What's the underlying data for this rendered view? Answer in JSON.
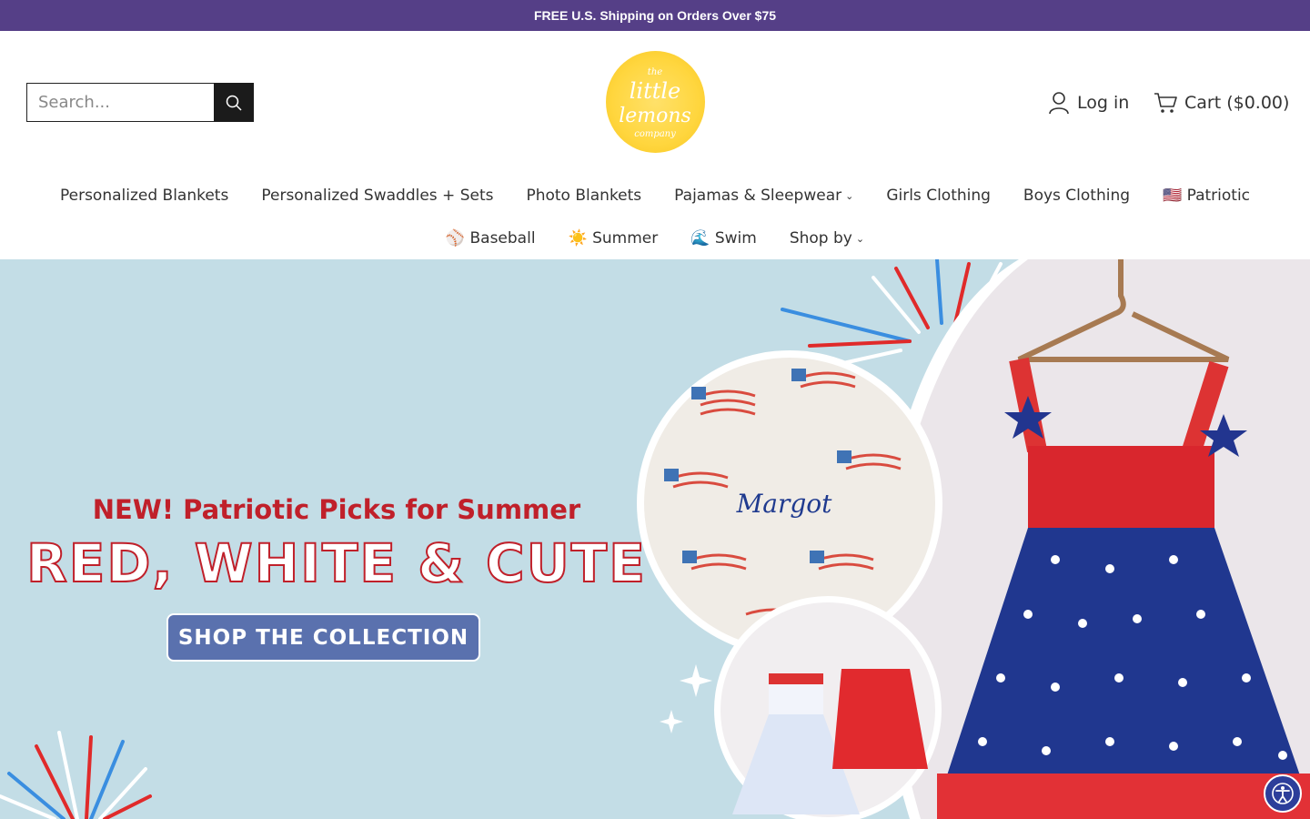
{
  "announcement": "FREE U.S. Shipping on Orders Over $75",
  "search": {
    "placeholder": "Search..."
  },
  "logo": {
    "alt": "the little lemons company"
  },
  "account": {
    "login_label": "Log in"
  },
  "cart": {
    "label": "Cart ($0.00)"
  },
  "nav": {
    "row1": [
      {
        "label": "Personalized Blankets"
      },
      {
        "label": "Personalized Swaddles + Sets"
      },
      {
        "label": "Photo Blankets"
      },
      {
        "label": "Pajamas & Sleepwear",
        "dropdown": true
      },
      {
        "label": "Girls Clothing"
      },
      {
        "label": "Boys Clothing"
      },
      {
        "label": "🇺🇸 Patriotic"
      }
    ],
    "row2": [
      {
        "label": "⚾ Baseball"
      },
      {
        "label": "☀️ Summer"
      },
      {
        "label": "🌊 Swim"
      },
      {
        "label": "Shop by",
        "dropdown": true
      }
    ]
  },
  "hero": {
    "kicker": "NEW! Patriotic Picks for Summer",
    "title": "RED, WHITE & CUTE",
    "cta": "SHOP THE COLLECTION",
    "blanket_name": "Margot"
  },
  "colors": {
    "announcement_bg": "#553f87",
    "hero_bg": "#c3dde6",
    "cta_bg": "#5a71ae",
    "accent_red": "#c0202a",
    "navy": "#1f3a8f"
  }
}
